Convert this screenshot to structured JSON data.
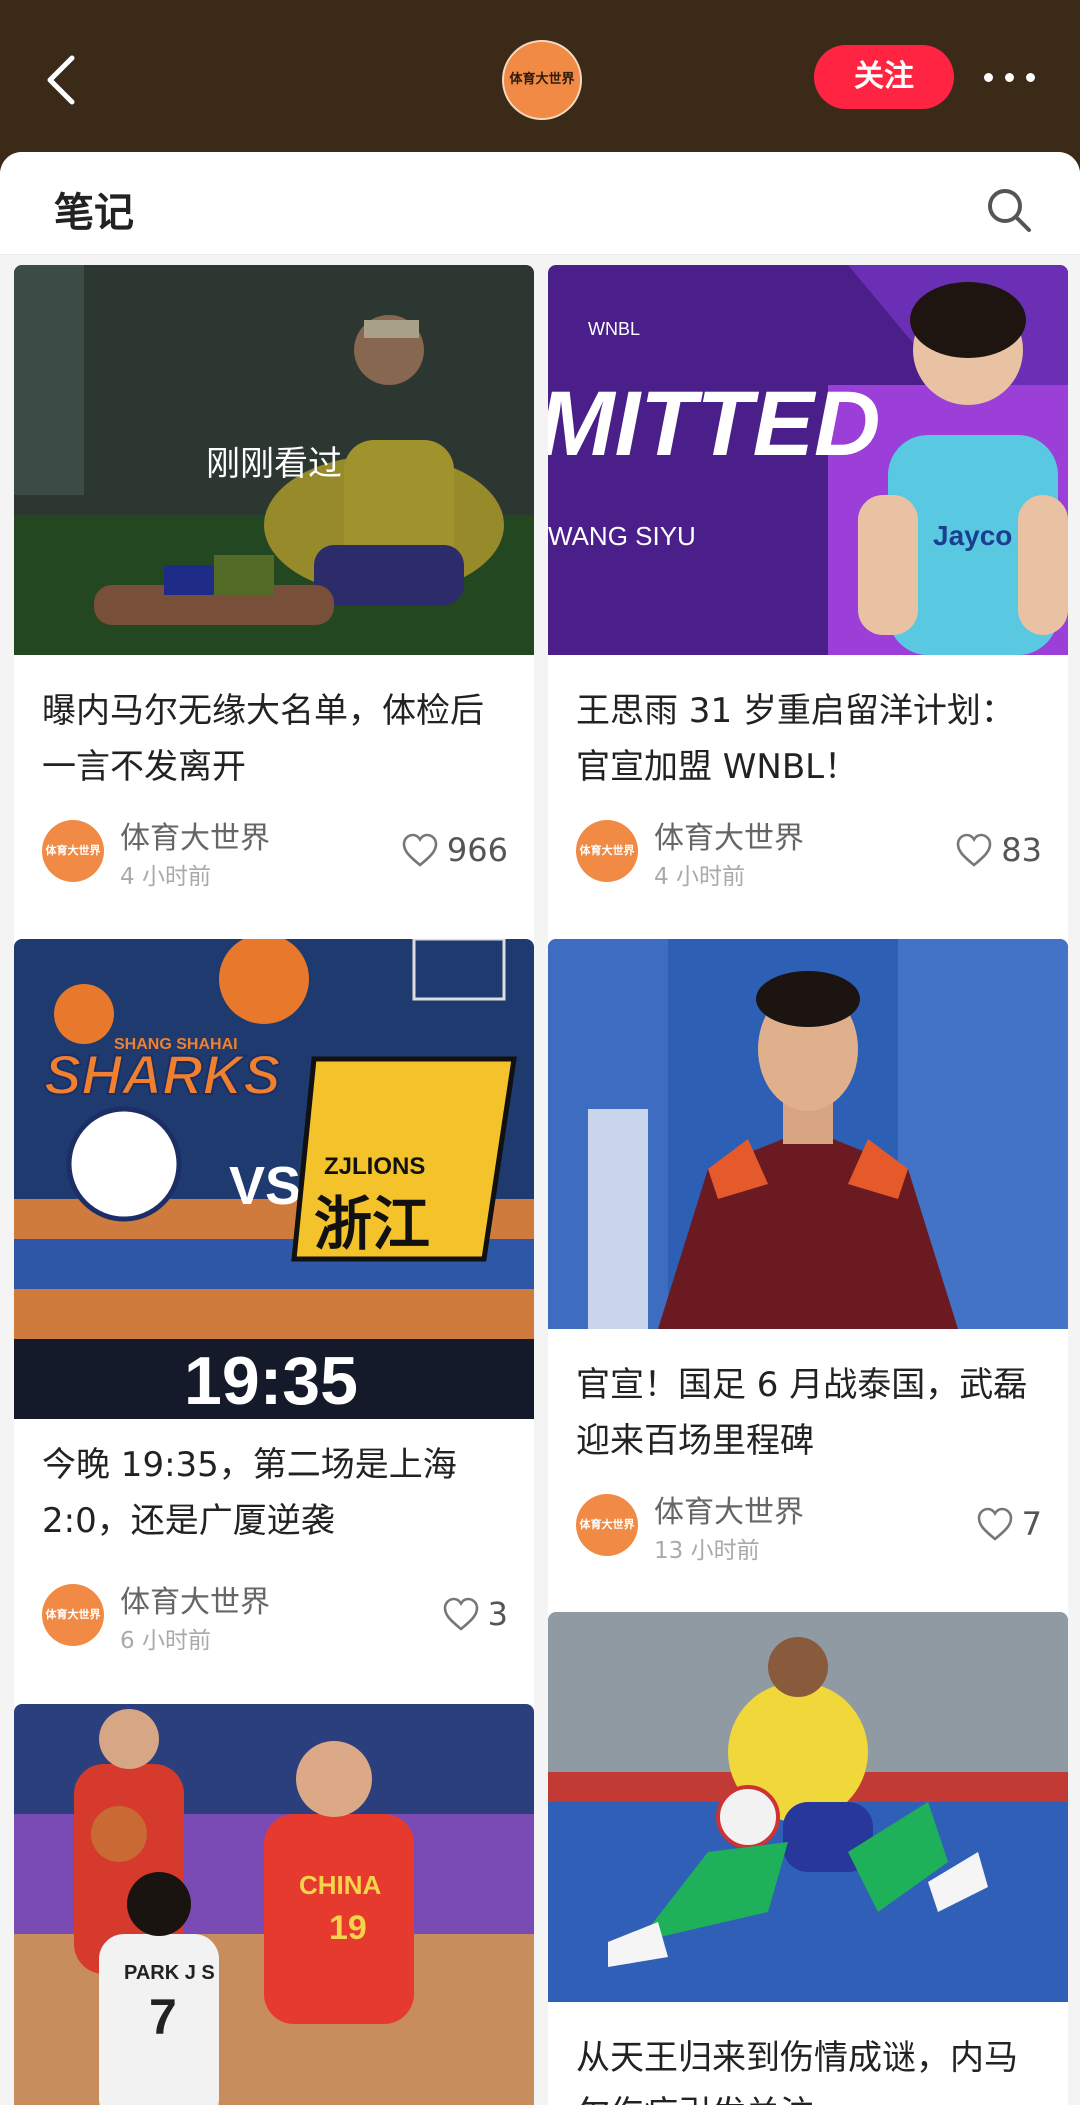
{
  "header": {
    "back_icon": "chevron-left-icon",
    "profile_avatar_text": "体育大世界",
    "follow_label": "关注",
    "more_icon": "more-dots-icon"
  },
  "sheet": {
    "title": "笔记",
    "search_icon": "search-icon"
  },
  "notes": [
    {
      "title": "曝内马尔无缘大名单，体检后一言不发离开",
      "author": "体育大世界",
      "avatar_text": "体育大世界",
      "time": "4 小时前",
      "likes": "966",
      "overlay": "刚刚看过"
    },
    {
      "title": "王思雨 31 岁重启留洋计划：官宣加盟 WNBL！",
      "author": "体育大世界",
      "avatar_text": "体育大世界",
      "time": "4 小时前",
      "likes": "83",
      "image_text": {
        "league": "WNBL",
        "headline": "MITTED",
        "name": "WANG SIYU",
        "jersey": "Jayco"
      }
    },
    {
      "title": "今晚 19:35，第二场是上海 2:0，还是广厦逆袭",
      "author": "体育大世界",
      "avatar_text": "体育大世界",
      "time": "6 小时前",
      "likes": "3",
      "image_text": {
        "team_a_city": "SHANG SHAHAI",
        "team_a": "SHARKS",
        "vs": "VS",
        "team_b": "ZJLIONS",
        "team_b_cn": "浙江",
        "clock": "19:35"
      }
    },
    {
      "title": "官宣！国足 6 月战泰国，武磊迎来百场里程碑",
      "author": "体育大世界",
      "avatar_text": "体育大世界",
      "time": "13 小时前",
      "likes": "7"
    },
    {
      "image_text": {
        "jersey_team": "CHINA",
        "jersey_number": "19",
        "opponent_name": "PARK J S",
        "opponent_number": "7"
      }
    },
    {
      "title": "从天王归来到伤情成谜，内马尔伤病引发关注"
    }
  ]
}
